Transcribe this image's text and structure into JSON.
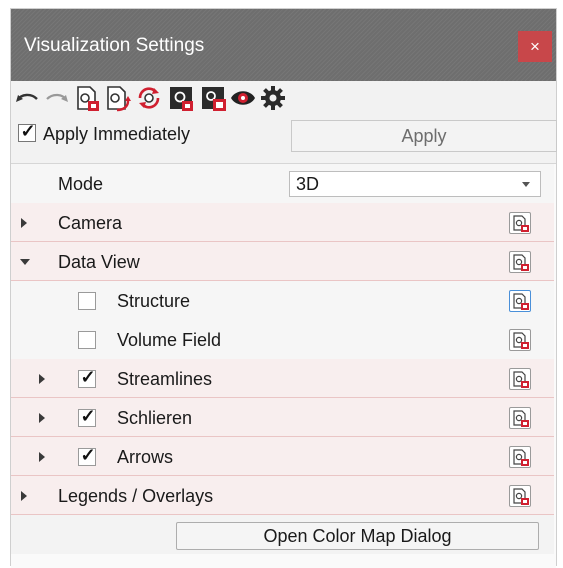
{
  "window": {
    "title": "Visualization Settings",
    "close_glyph": "×"
  },
  "toolbar": {
    "icons": [
      "undo-icon",
      "redo-icon",
      "export-settings-icon",
      "import-settings-icon",
      "reload-settings-icon",
      "save-settings-icon",
      "save-default-icon",
      "preview-eye-icon",
      "settings-gear-icon"
    ]
  },
  "apply": {
    "checkbox_label": "Apply Immediately",
    "checked": true,
    "button_label": "Apply"
  },
  "tree": {
    "mode": {
      "label": "Mode",
      "value": "3D"
    },
    "camera": {
      "label": "Camera"
    },
    "data_view": {
      "label": "Data View"
    },
    "structure": {
      "label": "Structure",
      "checked": false
    },
    "volume_field": {
      "label": "Volume Field",
      "checked": false
    },
    "streamlines": {
      "label": "Streamlines",
      "checked": true
    },
    "schlieren": {
      "label": "Schlieren",
      "checked": true
    },
    "arrows": {
      "label": "Arrows",
      "checked": true
    },
    "legends": {
      "label": "Legends / Overlays"
    },
    "color_map_button": "Open Color Map Dialog"
  },
  "check_glyph": "✓"
}
